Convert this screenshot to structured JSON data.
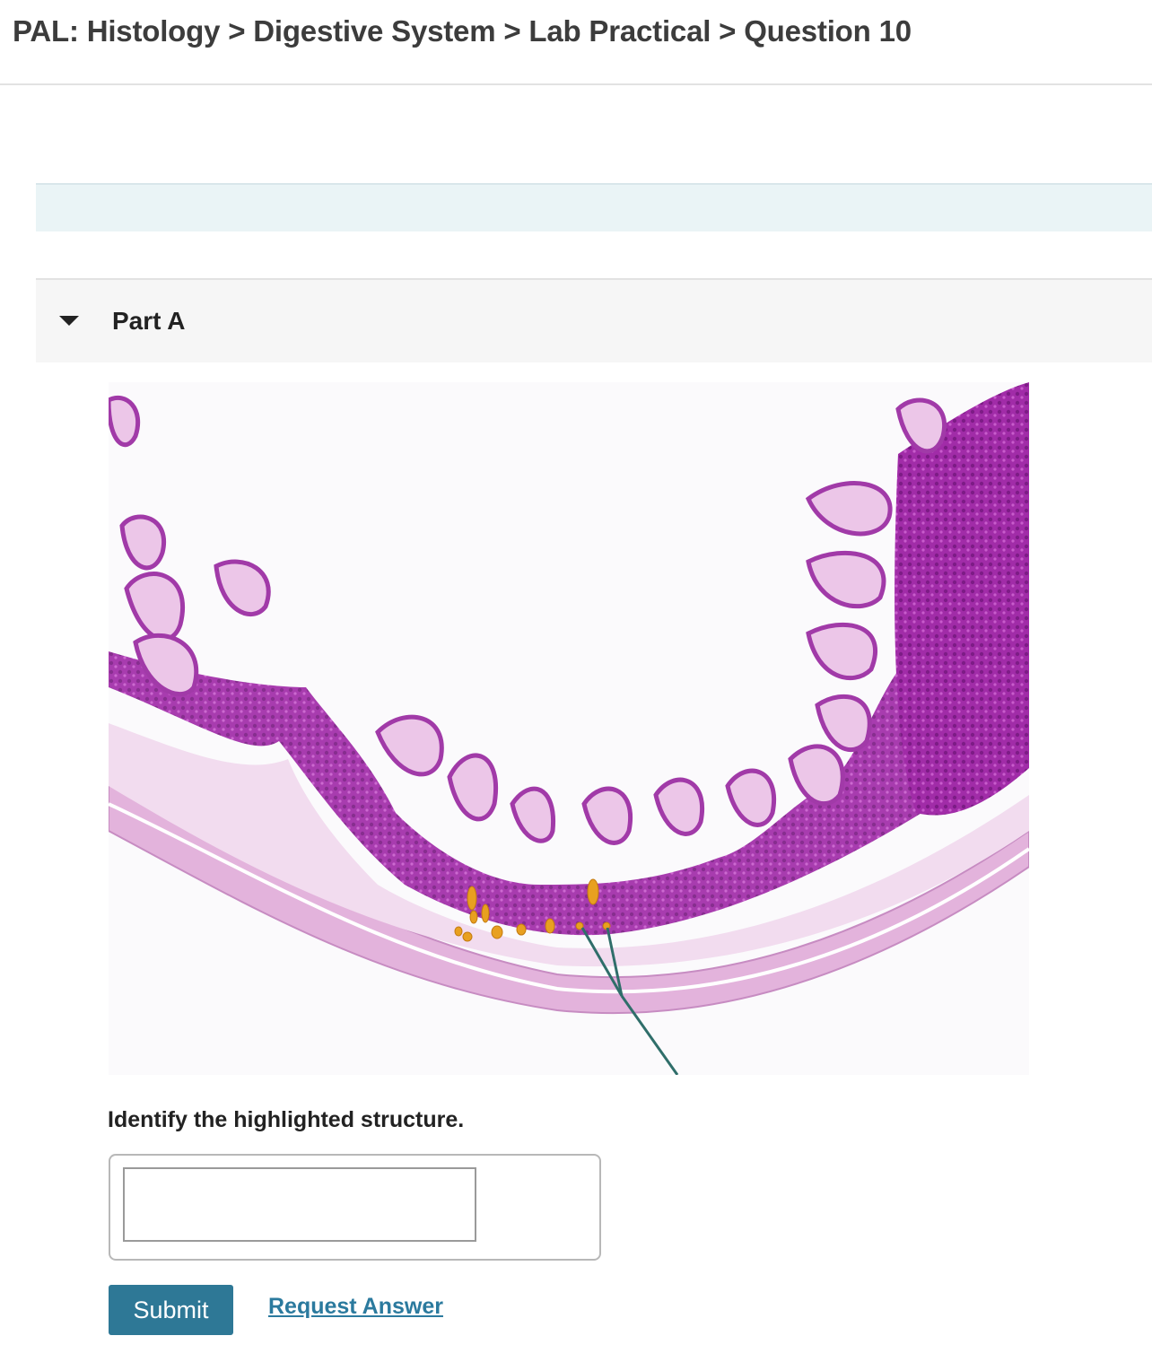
{
  "header": {
    "breadcrumb": "PAL: Histology > Digestive System > Lab Practical > Question 10"
  },
  "part": {
    "label": "Part A",
    "expanded": true
  },
  "figure": {
    "subject": "cross-section of intestinal wall with villi and glands",
    "highlight_color": "#e8a020",
    "stain_color": "#9a2a9e",
    "leader_line_color": "#2f6e6a"
  },
  "question": {
    "prompt": "Identify the highlighted structure.",
    "answer_value": "",
    "answer_placeholder": ""
  },
  "actions": {
    "submit_label": "Submit",
    "request_answer_label": "Request Answer"
  }
}
